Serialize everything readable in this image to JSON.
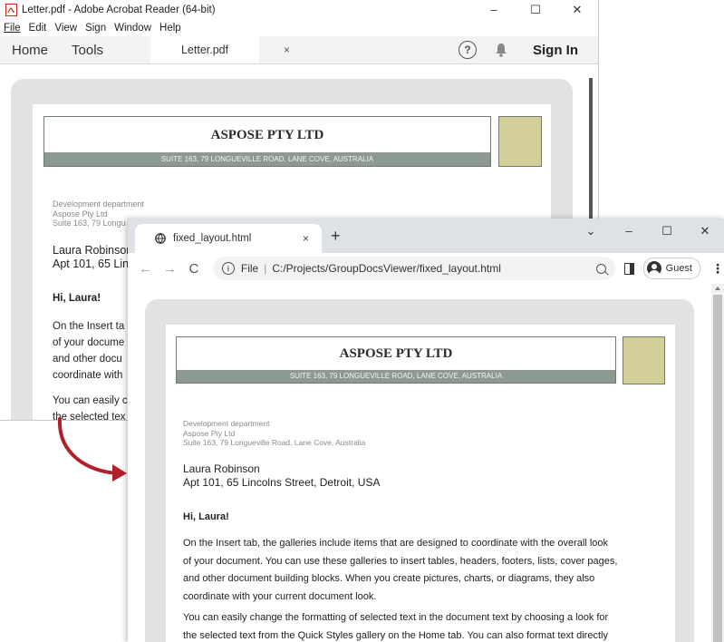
{
  "acrobat": {
    "title": "Letter.pdf - Adobe Acrobat Reader (64-bit)",
    "window_controls": [
      "–",
      "☐",
      "✕"
    ],
    "menu": [
      "File",
      "Edit",
      "View",
      "Sign",
      "Window",
      "Help"
    ],
    "nav_home": "Home",
    "nav_tools": "Tools",
    "doc_tab": "Letter.pdf",
    "doc_tab_close": "×",
    "help_glyph": "?",
    "sign_in": "Sign In",
    "letter": {
      "company": "ASPOSE PTY LTD",
      "address_band": "SUITE 163, 79 LONGUEVILLE ROAD, LANE COVE, AUSTRALIA",
      "dept": "Development department",
      "org": "Aspose Pty Ltd",
      "suite": "Suite 163, 79 Longu",
      "recipient_name": "Laura Robinson",
      "recipient_addr": "Apt 101, 65 Linc",
      "greeting": "Hi, Laura!",
      "p1_lines": [
        "On the Insert ta",
        "of your docume",
        "and other docu",
        "coordinate with"
      ],
      "p2_lines": [
        "You can easily c",
        "the selected tex"
      ]
    }
  },
  "chrome": {
    "tab_title": "fixed_layout.html",
    "tab_close": "×",
    "new_tab": "+",
    "window_controls": [
      "⌄",
      "–",
      "☐",
      "✕"
    ],
    "back": "←",
    "forward": "→",
    "reload": "C",
    "address_scheme": "File",
    "address_sep": "|",
    "address_path": "C:/Projects/GroupDocsViewer/fixed_layout.html",
    "profile": "Guest",
    "menu_glyph": "⋮",
    "letter": {
      "company": "ASPOSE PTY LTD",
      "address_band": "SUITE 163, 79 LONGUEVILLE ROAD, LANE COVE, AUSTRALIA",
      "dept": "Development department",
      "org": "Aspose Pty Ltd",
      "suite": "Suite 163, 79 Longueville Road, Lane Cove, Australia",
      "recipient_name": "Laura Robinson",
      "recipient_addr": "Apt 101, 65 Lincolns Street, Detroit, USA",
      "greeting": "Hi, Laura!",
      "p1_lines": [
        "On the Insert tab, the galleries include items that are designed to coordinate with the overall look",
        "of your document. You can use these galleries to insert tables, headers, footers, lists, cover pages,",
        "and other document building blocks. When you create pictures, charts, or diagrams, they also",
        "coordinate with your current document look."
      ],
      "p2_lines": [
        "You can easily change the formatting of selected text in the document text by choosing a look for",
        "the selected text from the Quick Styles gallery on the Home tab. You can also format text directly"
      ]
    }
  },
  "colors": {
    "header_band": "#8c9a90",
    "logo_box": "#d3cf98",
    "arrow": "#b3202a",
    "page_frame": "#e2e2e2"
  }
}
